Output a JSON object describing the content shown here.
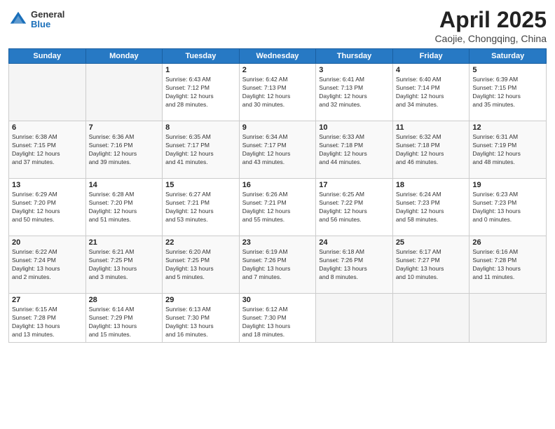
{
  "header": {
    "logo_general": "General",
    "logo_blue": "Blue",
    "month_title": "April 2025",
    "subtitle": "Caojie, Chongqing, China"
  },
  "weekdays": [
    "Sunday",
    "Monday",
    "Tuesday",
    "Wednesday",
    "Thursday",
    "Friday",
    "Saturday"
  ],
  "rows": [
    [
      {
        "day": "",
        "info": ""
      },
      {
        "day": "",
        "info": ""
      },
      {
        "day": "1",
        "info": "Sunrise: 6:43 AM\nSunset: 7:12 PM\nDaylight: 12 hours\nand 28 minutes."
      },
      {
        "day": "2",
        "info": "Sunrise: 6:42 AM\nSunset: 7:13 PM\nDaylight: 12 hours\nand 30 minutes."
      },
      {
        "day": "3",
        "info": "Sunrise: 6:41 AM\nSunset: 7:13 PM\nDaylight: 12 hours\nand 32 minutes."
      },
      {
        "day": "4",
        "info": "Sunrise: 6:40 AM\nSunset: 7:14 PM\nDaylight: 12 hours\nand 34 minutes."
      },
      {
        "day": "5",
        "info": "Sunrise: 6:39 AM\nSunset: 7:15 PM\nDaylight: 12 hours\nand 35 minutes."
      }
    ],
    [
      {
        "day": "6",
        "info": "Sunrise: 6:38 AM\nSunset: 7:15 PM\nDaylight: 12 hours\nand 37 minutes."
      },
      {
        "day": "7",
        "info": "Sunrise: 6:36 AM\nSunset: 7:16 PM\nDaylight: 12 hours\nand 39 minutes."
      },
      {
        "day": "8",
        "info": "Sunrise: 6:35 AM\nSunset: 7:17 PM\nDaylight: 12 hours\nand 41 minutes."
      },
      {
        "day": "9",
        "info": "Sunrise: 6:34 AM\nSunset: 7:17 PM\nDaylight: 12 hours\nand 43 minutes."
      },
      {
        "day": "10",
        "info": "Sunrise: 6:33 AM\nSunset: 7:18 PM\nDaylight: 12 hours\nand 44 minutes."
      },
      {
        "day": "11",
        "info": "Sunrise: 6:32 AM\nSunset: 7:18 PM\nDaylight: 12 hours\nand 46 minutes."
      },
      {
        "day": "12",
        "info": "Sunrise: 6:31 AM\nSunset: 7:19 PM\nDaylight: 12 hours\nand 48 minutes."
      }
    ],
    [
      {
        "day": "13",
        "info": "Sunrise: 6:29 AM\nSunset: 7:20 PM\nDaylight: 12 hours\nand 50 minutes."
      },
      {
        "day": "14",
        "info": "Sunrise: 6:28 AM\nSunset: 7:20 PM\nDaylight: 12 hours\nand 51 minutes."
      },
      {
        "day": "15",
        "info": "Sunrise: 6:27 AM\nSunset: 7:21 PM\nDaylight: 12 hours\nand 53 minutes."
      },
      {
        "day": "16",
        "info": "Sunrise: 6:26 AM\nSunset: 7:21 PM\nDaylight: 12 hours\nand 55 minutes."
      },
      {
        "day": "17",
        "info": "Sunrise: 6:25 AM\nSunset: 7:22 PM\nDaylight: 12 hours\nand 56 minutes."
      },
      {
        "day": "18",
        "info": "Sunrise: 6:24 AM\nSunset: 7:23 PM\nDaylight: 12 hours\nand 58 minutes."
      },
      {
        "day": "19",
        "info": "Sunrise: 6:23 AM\nSunset: 7:23 PM\nDaylight: 13 hours\nand 0 minutes."
      }
    ],
    [
      {
        "day": "20",
        "info": "Sunrise: 6:22 AM\nSunset: 7:24 PM\nDaylight: 13 hours\nand 2 minutes."
      },
      {
        "day": "21",
        "info": "Sunrise: 6:21 AM\nSunset: 7:25 PM\nDaylight: 13 hours\nand 3 minutes."
      },
      {
        "day": "22",
        "info": "Sunrise: 6:20 AM\nSunset: 7:25 PM\nDaylight: 13 hours\nand 5 minutes."
      },
      {
        "day": "23",
        "info": "Sunrise: 6:19 AM\nSunset: 7:26 PM\nDaylight: 13 hours\nand 7 minutes."
      },
      {
        "day": "24",
        "info": "Sunrise: 6:18 AM\nSunset: 7:26 PM\nDaylight: 13 hours\nand 8 minutes."
      },
      {
        "day": "25",
        "info": "Sunrise: 6:17 AM\nSunset: 7:27 PM\nDaylight: 13 hours\nand 10 minutes."
      },
      {
        "day": "26",
        "info": "Sunrise: 6:16 AM\nSunset: 7:28 PM\nDaylight: 13 hours\nand 11 minutes."
      }
    ],
    [
      {
        "day": "27",
        "info": "Sunrise: 6:15 AM\nSunset: 7:28 PM\nDaylight: 13 hours\nand 13 minutes."
      },
      {
        "day": "28",
        "info": "Sunrise: 6:14 AM\nSunset: 7:29 PM\nDaylight: 13 hours\nand 15 minutes."
      },
      {
        "day": "29",
        "info": "Sunrise: 6:13 AM\nSunset: 7:30 PM\nDaylight: 13 hours\nand 16 minutes."
      },
      {
        "day": "30",
        "info": "Sunrise: 6:12 AM\nSunset: 7:30 PM\nDaylight: 13 hours\nand 18 minutes."
      },
      {
        "day": "",
        "info": ""
      },
      {
        "day": "",
        "info": ""
      },
      {
        "day": "",
        "info": ""
      }
    ]
  ]
}
